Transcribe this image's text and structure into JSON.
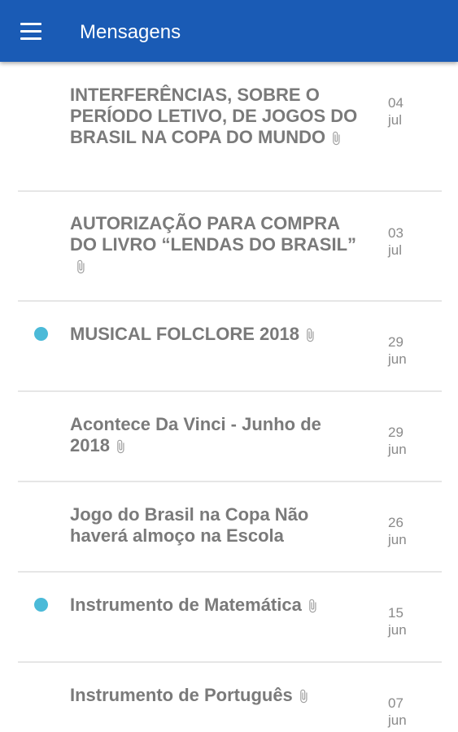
{
  "appbar": {
    "title": "Mensagens",
    "menu_icon": "menu-icon"
  },
  "colors": {
    "primary": "#1a5bb5",
    "unread": "#4bbad8",
    "text": "#7a7a7a"
  },
  "messages": [
    {
      "title": "INTERFERÊNCIAS, SOBRE O PERÍODO LETIVO, DE JOGOS DO BRASIL NA COPA DO MUNDO",
      "day": "04",
      "month": "jul",
      "attachment": true,
      "unread": false
    },
    {
      "title": "AUTORIZAÇÃO PARA COMPRA DO LIVRO “LENDAS DO BRASIL”",
      "day": "03",
      "month": "jul",
      "attachment": true,
      "unread": false
    },
    {
      "title": "MUSICAL FOLCLORE 2018",
      "day": "29",
      "month": "jun",
      "attachment": true,
      "unread": true
    },
    {
      "title": "Acontece Da Vinci - Junho de 2018",
      "day": "29",
      "month": "jun",
      "attachment": true,
      "unread": false
    },
    {
      "title": "Jogo do Brasil na Copa Não haverá almoço na Escola",
      "day": "26",
      "month": "jun",
      "attachment": false,
      "unread": false
    },
    {
      "title": "Instrumento de Matemática",
      "day": "15",
      "month": "jun",
      "attachment": true,
      "unread": true
    },
    {
      "title": "Instrumento de Português",
      "day": "07",
      "month": "jun",
      "attachment": true,
      "unread": false
    }
  ]
}
